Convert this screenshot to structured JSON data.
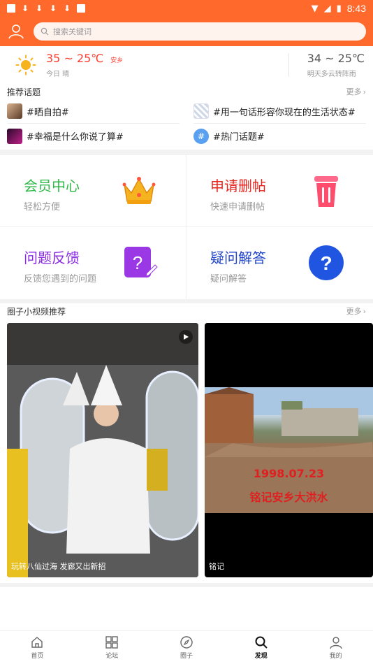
{
  "status_bar": {
    "time": "8:43",
    "colors": {
      "bg": "#ff6a2c"
    }
  },
  "header": {
    "search_placeholder": "搜索关键词"
  },
  "weather": {
    "today_temp": "35 ~ 25℃",
    "city": "安乡",
    "today_desc": "今日 晴",
    "tomorrow_temp": "34 ~ 25℃",
    "tomorrow_desc": "明天多云转阵雨"
  },
  "recommend": {
    "title": "推荐话题",
    "more": "更多",
    "topics": [
      {
        "label": "#晒自拍#",
        "thumb": "selfie-thumbnail"
      },
      {
        "label": "#用一句话形容你现在的生活状态#",
        "thumb": "text-thumbnail"
      },
      {
        "label": "#幸福是什么你说了算#",
        "thumb": "dark-thumbnail"
      },
      {
        "label": "#热门话题#",
        "thumb": "hash-icon"
      }
    ]
  },
  "features": [
    {
      "title": "会员中心",
      "sub": "轻松方便",
      "color": "#2fb84a",
      "icon": "crown-icon"
    },
    {
      "title": "申请删帖",
      "sub": "快速申请删帖",
      "color": "#e8231c",
      "icon": "trash-icon"
    },
    {
      "title": "问题反馈",
      "sub": "反馈您遇到的问题",
      "color": "#8a2be2",
      "icon": "edit-question-icon"
    },
    {
      "title": "疑问解答",
      "sub": "疑问解答",
      "color": "#2346c8",
      "icon": "help-circle-icon"
    }
  ],
  "videos": {
    "title": "圈子小视频推荐",
    "more": "更多",
    "items": [
      {
        "caption": "玩转八仙过海 发廊又出新招"
      },
      {
        "caption": "铭记",
        "overlay_date": "1998.07.23",
        "overlay_text": "铭记安乡大洪水"
      }
    ]
  },
  "nav": [
    {
      "label": "首页",
      "icon": "home-icon"
    },
    {
      "label": "论坛",
      "icon": "grid-icon"
    },
    {
      "label": "圈子",
      "icon": "compass-icon"
    },
    {
      "label": "发现",
      "icon": "search-icon",
      "active": true
    },
    {
      "label": "我的",
      "icon": "user-icon"
    }
  ]
}
